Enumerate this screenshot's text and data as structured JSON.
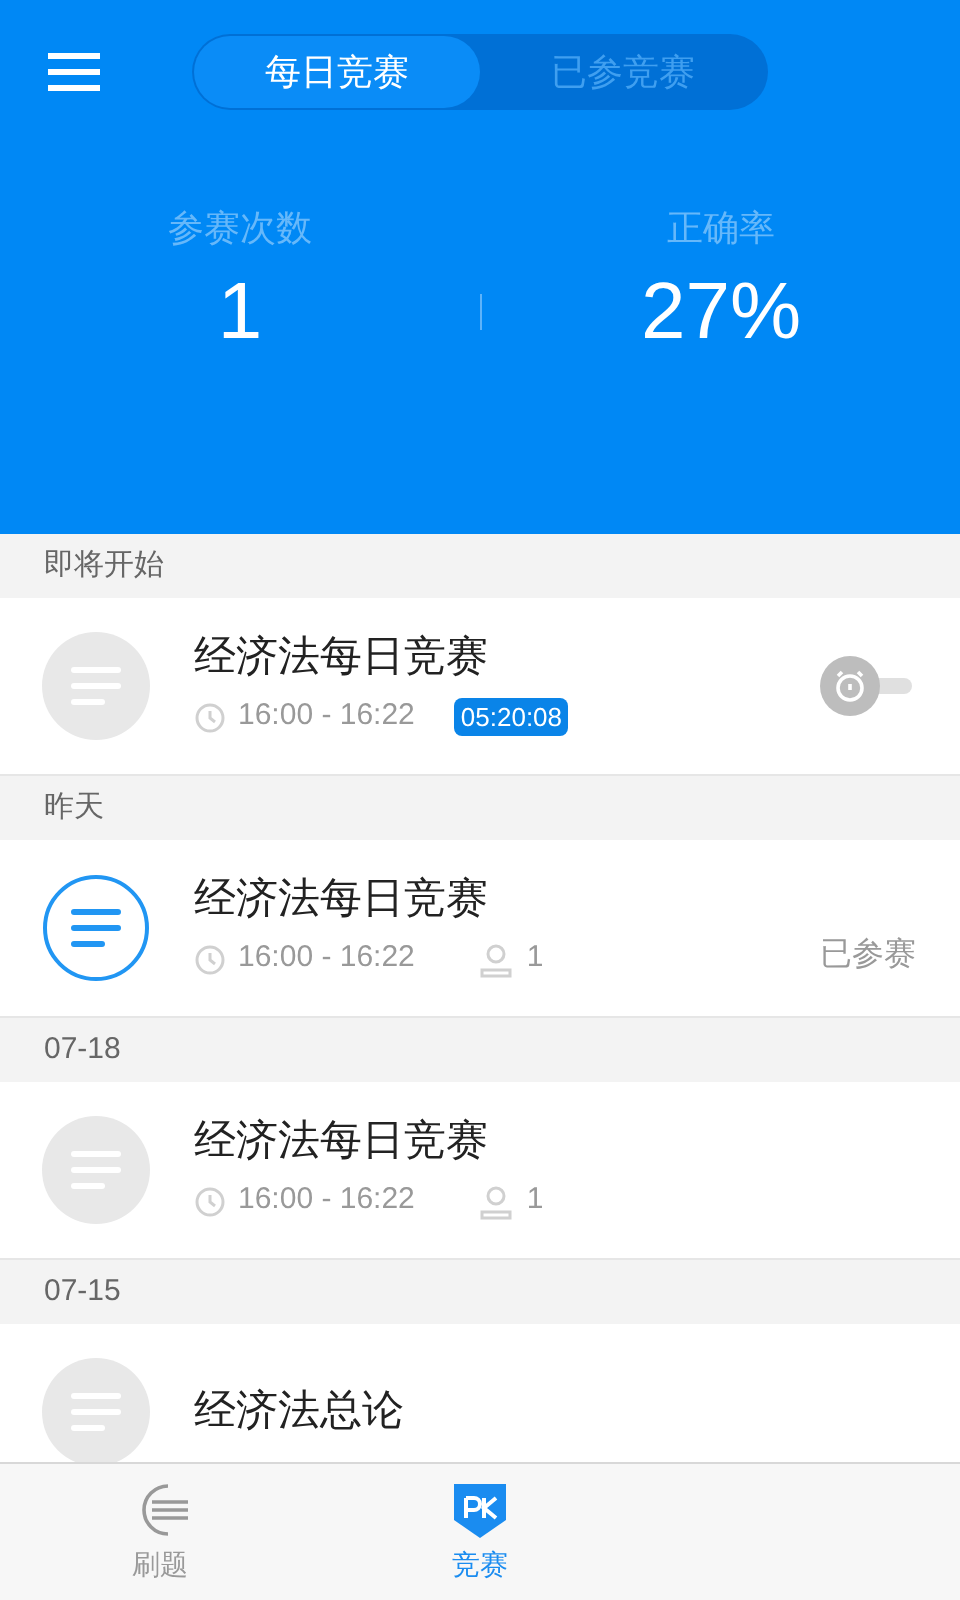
{
  "tabs": [
    {
      "label": "每日竞赛",
      "selected": true
    },
    {
      "label": "已参竞赛",
      "selected": false
    }
  ],
  "stats": [
    {
      "label": "参赛次数",
      "value": "1"
    },
    {
      "label": "正确率",
      "value": "27%"
    }
  ],
  "sections": [
    {
      "title": "即将开始",
      "items": [
        {
          "title": "经济法每日竞赛",
          "active": false,
          "time": "16:00 - 16:22",
          "countdown": "05:20:08",
          "alarm": {
            "on": false
          }
        }
      ]
    },
    {
      "title": "昨天",
      "items": [
        {
          "title": "经济法每日竞赛",
          "active": true,
          "time": "16:00 - 16:22",
          "participants": "1",
          "status": "已参赛"
        }
      ]
    },
    {
      "title": "07-18",
      "items": [
        {
          "title": "经济法每日竞赛",
          "active": false,
          "time": "16:00 - 16:22",
          "participants": "1"
        }
      ]
    },
    {
      "title": "07-15",
      "items": [
        {
          "title": "经济法总论",
          "active": false
        }
      ]
    }
  ],
  "nav": [
    {
      "label": "刷题",
      "kind": "list",
      "selected": false
    },
    {
      "label": "竞赛",
      "kind": "pk",
      "selected": true
    }
  ]
}
